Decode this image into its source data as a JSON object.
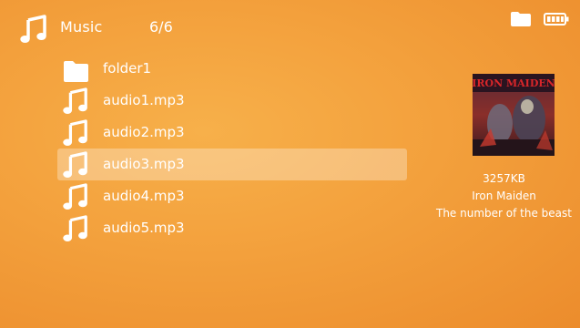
{
  "header": {
    "icon": "music-note-icon",
    "title": "Music",
    "count": "6/6"
  },
  "status": {
    "storage_icon": "folder-icon",
    "battery_icon": "battery-icon"
  },
  "files": [
    {
      "type": "folder",
      "icon": "folder-icon",
      "label": "folder1",
      "selected": false
    },
    {
      "type": "audio",
      "icon": "music-note-icon",
      "label": "audio1.mp3",
      "selected": false
    },
    {
      "type": "audio",
      "icon": "music-note-icon",
      "label": "audio2.mp3",
      "selected": false
    },
    {
      "type": "audio",
      "icon": "music-note-icon",
      "label": "audio3.mp3",
      "selected": true
    },
    {
      "type": "audio",
      "icon": "music-note-icon",
      "label": "audio4.mp3",
      "selected": false
    },
    {
      "type": "audio",
      "icon": "music-note-icon",
      "label": "audio5.mp3",
      "selected": false
    }
  ],
  "details": {
    "cover_title": "IRON MAIDEN",
    "size": "3257KB",
    "artist": "Iron Maiden",
    "album": "The number of the beast"
  },
  "colors": {
    "background": "#f3a03c",
    "highlight": "rgba(255,255,255,0.30)",
    "text": "#ffffff"
  }
}
